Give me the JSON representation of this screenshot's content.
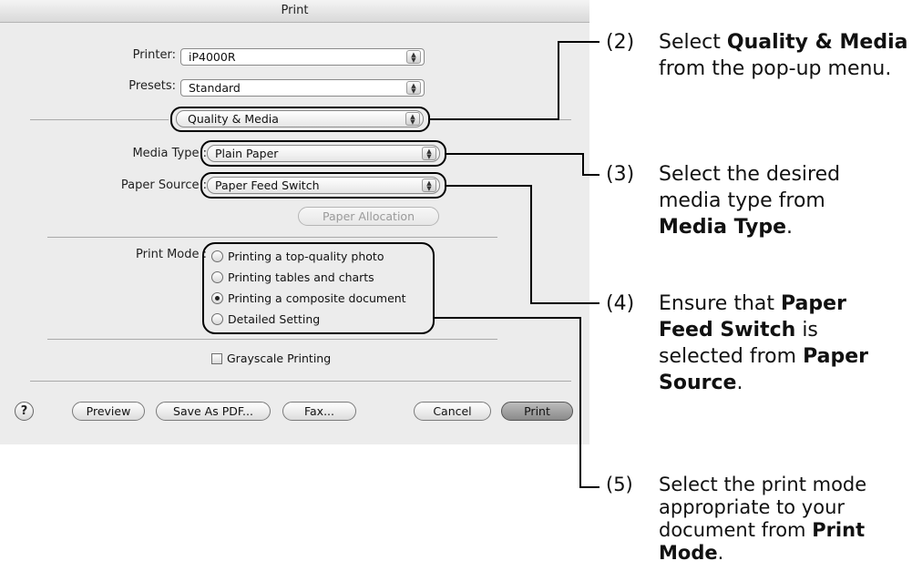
{
  "window": {
    "title": "Print"
  },
  "printer": {
    "label": "Printer:",
    "value": "iP4000R"
  },
  "presets": {
    "label": "Presets:",
    "value": "Standard"
  },
  "panel_menu": {
    "value": "Quality & Media"
  },
  "media_type": {
    "label": "Media Type :",
    "value": "Plain Paper"
  },
  "paper_source": {
    "label": "Paper Source :",
    "value": "Paper Feed Switch"
  },
  "paper_allocation": {
    "label": "Paper Allocation"
  },
  "print_mode": {
    "label": "Print Mode :",
    "options": [
      {
        "label": "Printing a top-quality photo",
        "selected": false
      },
      {
        "label": "Printing tables and charts",
        "selected": false
      },
      {
        "label": "Printing a composite document",
        "selected": true
      },
      {
        "label": "Detailed Setting",
        "selected": false
      }
    ]
  },
  "grayscale": {
    "label": "Grayscale Printing",
    "checked": false
  },
  "buttons": {
    "help": "?",
    "preview": "Preview",
    "save_pdf": "Save As PDF...",
    "fax": "Fax...",
    "cancel": "Cancel",
    "print": "Print"
  },
  "annotations": [
    {
      "num": "(2)",
      "parts": [
        [
          "Select ",
          false
        ],
        [
          "Quality & Media",
          true
        ],
        [
          " from the pop-up menu.",
          false
        ]
      ]
    },
    {
      "num": "(3)",
      "parts": [
        [
          "Select the desired media type from ",
          false
        ],
        [
          "Media Type",
          true
        ],
        [
          ".",
          false
        ]
      ]
    },
    {
      "num": "(4)",
      "parts": [
        [
          "Ensure that ",
          false
        ],
        [
          "Paper Feed Switch",
          true
        ],
        [
          " is selected from ",
          false
        ],
        [
          "Paper Source",
          true
        ],
        [
          ".",
          false
        ]
      ]
    },
    {
      "num": "(5)",
      "parts": [
        [
          "Select the print mode appropriate to your document from ",
          false
        ],
        [
          "Print Mode",
          true
        ],
        [
          ".",
          false
        ]
      ]
    }
  ]
}
